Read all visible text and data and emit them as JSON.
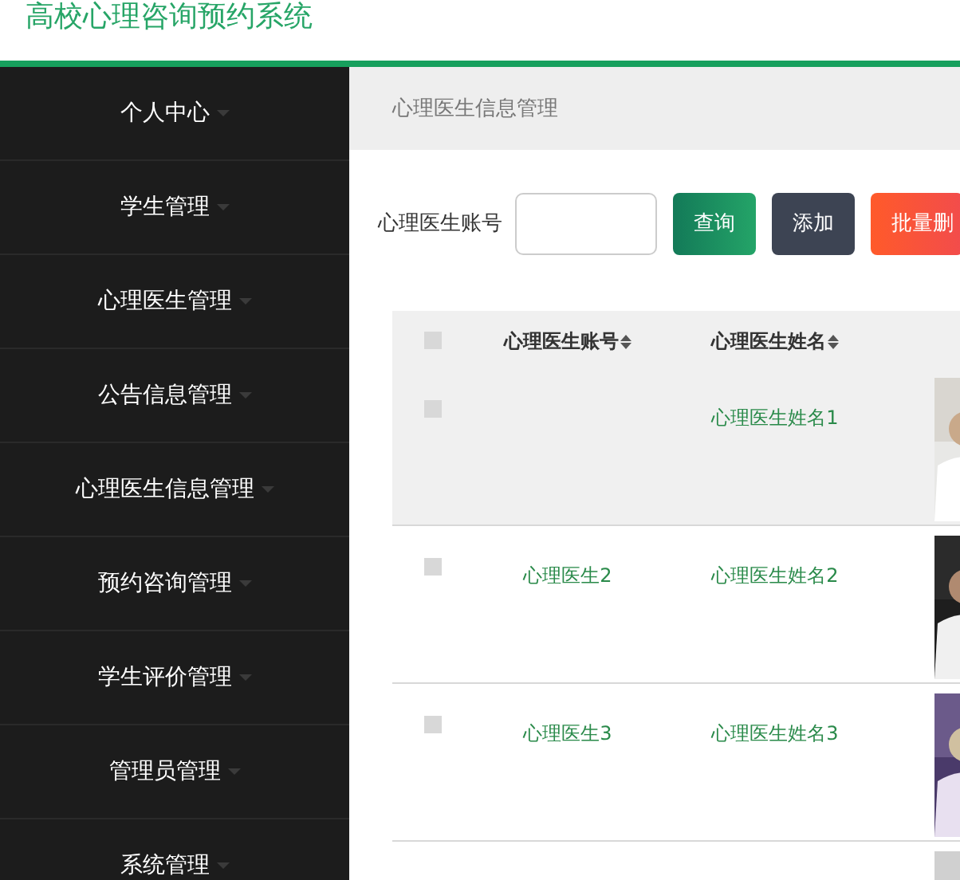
{
  "header": {
    "title": "高校心理咨询预约系统"
  },
  "sidebar": {
    "items": [
      {
        "label": "个人中心"
      },
      {
        "label": "学生管理"
      },
      {
        "label": "心理医生管理"
      },
      {
        "label": "公告信息管理"
      },
      {
        "label": "心理医生信息管理"
      },
      {
        "label": "预约咨询管理"
      },
      {
        "label": "学生评价管理"
      },
      {
        "label": "管理员管理"
      },
      {
        "label": "系统管理"
      }
    ]
  },
  "breadcrumb": "心理医生信息管理",
  "search": {
    "label": "心理医生账号",
    "buttons": [
      {
        "kind": "search",
        "label": "查询"
      },
      {
        "kind": "add",
        "label": "添加"
      },
      {
        "kind": "delete",
        "label": "批量删"
      }
    ]
  },
  "table": {
    "header_checked": false,
    "columns": [
      "心理医生账号",
      "心理医生姓名"
    ],
    "rows": [
      {
        "checked": false,
        "selected": true,
        "account": "",
        "name": "心理医生姓名1",
        "photo": {
          "kind": "picture"
        }
      },
      {
        "checked": false,
        "selected": false,
        "account": "心理医生2",
        "name": "心理医生姓名2",
        "photo": {
          "kind": "picture"
        }
      },
      {
        "checked": false,
        "selected": false,
        "account": "心理医生3",
        "name": "心理医生姓名3",
        "photo": {
          "kind": "picture"
        }
      },
      {
        "photo": {
          "kind": "picture"
        }
      }
    ]
  }
}
